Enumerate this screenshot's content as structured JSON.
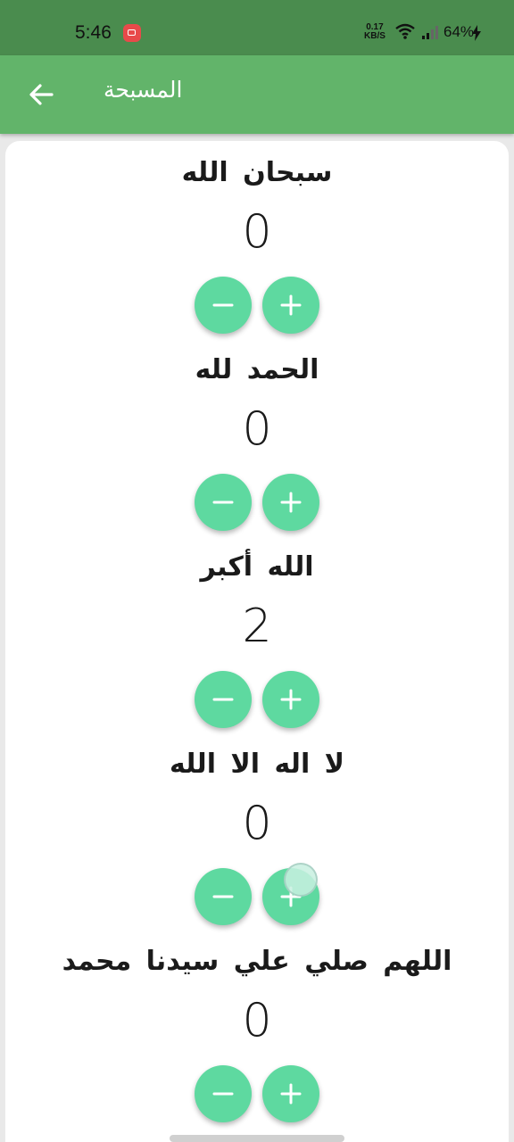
{
  "status_bar": {
    "time": "5:46",
    "net_speed_value": "0.17",
    "net_speed_unit": "KB/S",
    "battery": "64%"
  },
  "app_bar": {
    "title": "المسبحة",
    "back_icon": "arrow-back-icon"
  },
  "counters": [
    {
      "label": "سبحان الله",
      "count": "0"
    },
    {
      "label": "الحمد لله",
      "count": "0"
    },
    {
      "label": "الله أكبر",
      "count": "2"
    },
    {
      "label": "لا اله الا الله",
      "count": "0"
    },
    {
      "label": "اللهم صلي علي سيدنا محمد",
      "count": "0"
    }
  ],
  "colors": {
    "status_bar": "#4a8c4e",
    "app_bar": "#62b46a",
    "fab": "#5ed9a0"
  }
}
